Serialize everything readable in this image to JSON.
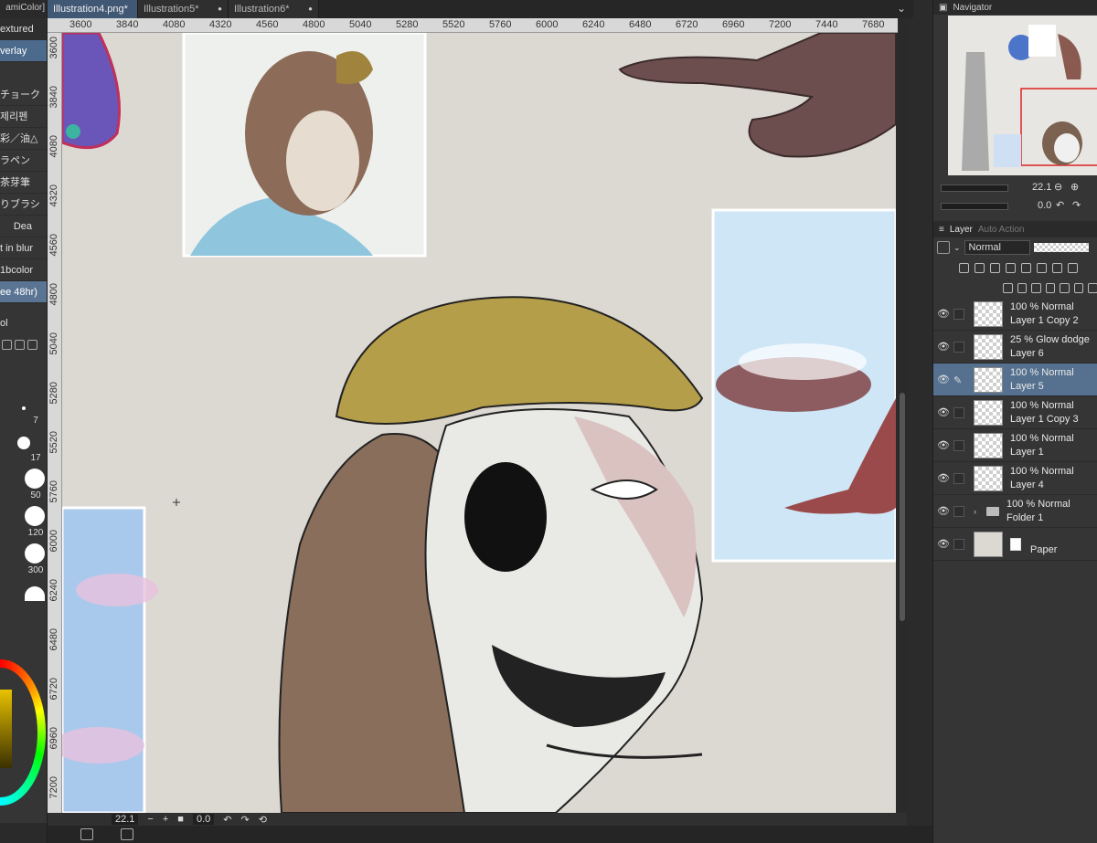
{
  "left_panel": {
    "top_label": "amiColor]",
    "items": [
      {
        "label": "extured"
      },
      {
        "label": "verlay"
      },
      {
        "label": "チョーク"
      },
      {
        "label": "제리펜"
      },
      {
        "label": "彩／油△"
      },
      {
        "label": "ラペン"
      },
      {
        "label": "茶芽筆"
      },
      {
        "label": "りブラシ"
      },
      {
        "label": "Dea"
      },
      {
        "label": "t in blur"
      },
      {
        "label": "1bcolor"
      },
      {
        "label": "ee 48hr)"
      },
      {
        "label": "ol"
      }
    ],
    "brush_sizes": [
      "7",
      "17",
      "50",
      "120",
      "300",
      ""
    ]
  },
  "tabs": [
    {
      "label": "Illustration4.png*"
    },
    {
      "label": "Illustration5*"
    },
    {
      "label": "Illustration6*"
    }
  ],
  "ruler": {
    "top": [
      "3600",
      "3840",
      "4080",
      "4320",
      "4560",
      "4800",
      "5040",
      "5280",
      "5520",
      "5760",
      "6000",
      "6240",
      "6480",
      "6720",
      "6960",
      "7200",
      "7440",
      "7680"
    ],
    "left": [
      "3600",
      "3840",
      "4080",
      "4320",
      "4560",
      "4800",
      "5040",
      "5280",
      "5520",
      "5760",
      "6000",
      "6240",
      "6480",
      "6720",
      "6960",
      "7200"
    ]
  },
  "status": {
    "zoom": "22.1",
    "angle": "0.0"
  },
  "navigator": {
    "title": "Navigator",
    "zoom": "22.1",
    "angle": "0.0"
  },
  "layer_panel": {
    "tab_layer": "Layer",
    "tab_auto_action": "Auto Action",
    "blend_mode": "Normal",
    "layers": [
      {
        "mode": "100 % Normal",
        "name": "Layer 1 Copy 2",
        "selected": false
      },
      {
        "mode": "25 % Glow dodge",
        "name": "Layer 6",
        "selected": false
      },
      {
        "mode": "100 % Normal",
        "name": "Layer 5",
        "selected": true
      },
      {
        "mode": "100 % Normal",
        "name": "Layer 1 Copy 3",
        "selected": false
      },
      {
        "mode": "100 % Normal",
        "name": "Layer 1",
        "selected": false
      },
      {
        "mode": "100 % Normal",
        "name": "Layer 4",
        "selected": false
      },
      {
        "mode": "100 % Normal",
        "name": "Folder 1",
        "selected": false
      },
      {
        "mode": "",
        "name": "Paper",
        "selected": false
      }
    ]
  },
  "colors": {
    "accent": "#415875",
    "selection": "#56718f",
    "canvas_bg": "#dcd8d2"
  }
}
